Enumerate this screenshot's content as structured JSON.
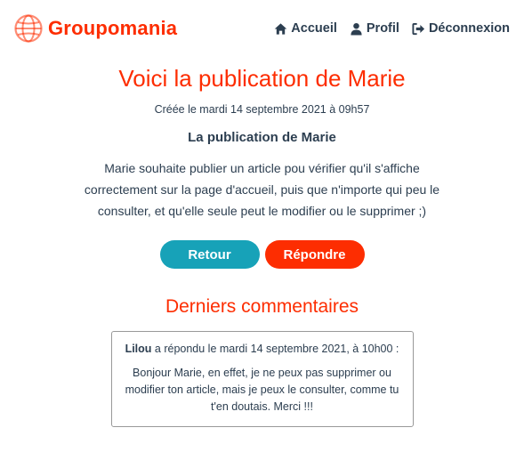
{
  "brand": {
    "name": "Groupomania",
    "accent_color": "#fd2d01",
    "logo_icon": "globe-icon"
  },
  "nav": {
    "items": [
      {
        "label": "Accueil",
        "icon": "home-icon"
      },
      {
        "label": "Profil",
        "icon": "user-icon"
      },
      {
        "label": "Déconnexion",
        "icon": "logout-icon"
      }
    ]
  },
  "post": {
    "page_title": "Voici la publication de Marie",
    "created": "Créée le mardi 14 septembre 2021 à 09h57",
    "title": "La publication de Marie",
    "body": "Marie souhaite publier un article pou vérifier qu'il s'affiche correctement sur la page d'accueil, puis que n'importe qui peu le consulter, et qu'elle seule peut le modifier ou le supprimer ;)"
  },
  "actions": {
    "back_label": "Retour",
    "back_color": "#17a2b8",
    "reply_label": "Répondre",
    "reply_color": "#fd2d01"
  },
  "comments": {
    "title": "Derniers commentaires",
    "items": [
      {
        "author": "Lilou",
        "meta": " a répondu le mardi 14 septembre 2021, à 10h00 :",
        "text": "Bonjour Marie, en effet, je ne peux pas supprimer ou modifier ton article, mais je peux le consulter, comme tu t'en doutais. Merci !!!"
      }
    ]
  },
  "colors": {
    "text": "#2c3e50",
    "title_red": "#fd2d01"
  }
}
